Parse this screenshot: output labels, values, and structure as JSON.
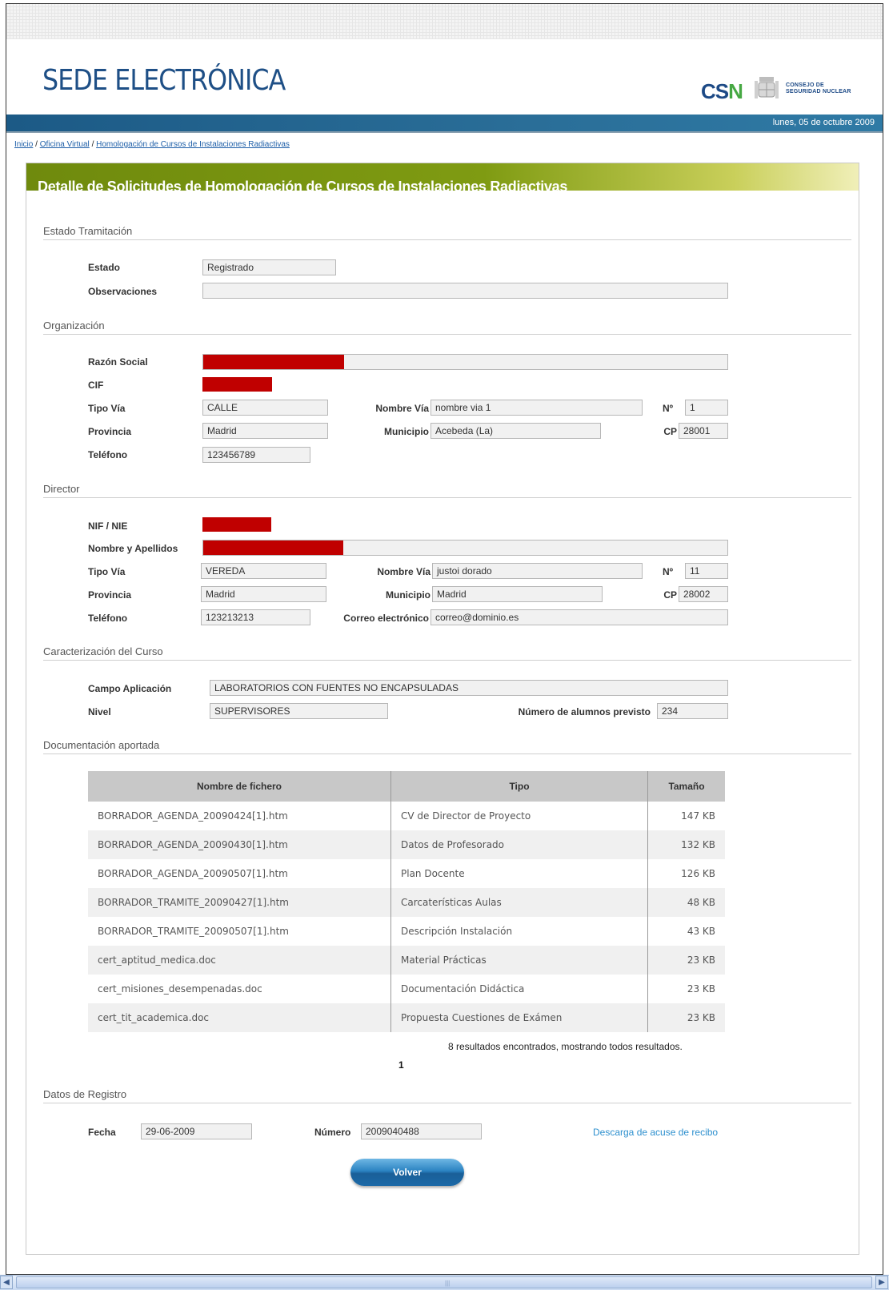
{
  "header": {
    "title": "SEDE ELECTRÓNICA",
    "logo": {
      "csn": "CSN",
      "line1": "CONSEJO DE",
      "line2": "SEGURIDAD NUCLEAR"
    },
    "date": "lunes, 05 de octubre 2009"
  },
  "breadcrumb": {
    "items": [
      "Inicio",
      "Oficina Virtual",
      "Homologación de Cursos de Instalaciones Radiactivas"
    ],
    "separator": "/"
  },
  "panel": {
    "title": "Detalle de Solicitudes de Homologación de Cursos de Instalaciones Radiactivas"
  },
  "estado_tramitacion": {
    "section": "Estado Tramitación",
    "estado_label": "Estado",
    "estado_value": "Registrado",
    "observaciones_label": "Observaciones",
    "observaciones_value": ""
  },
  "organizacion": {
    "section": "Organización",
    "razon_social_label": "Razón Social",
    "cif_label": "CIF",
    "tipo_via_label": "Tipo Vía",
    "tipo_via_value": "CALLE",
    "nombre_via_label": "Nombre Vía",
    "nombre_via_value": "nombre via 1",
    "numero_label": "Nº",
    "numero_value": "1",
    "provincia_label": "Provincia",
    "provincia_value": "Madrid",
    "municipio_label": "Municipio",
    "municipio_value": "Acebeda (La)",
    "cp_label": "CP",
    "cp_value": "28001",
    "telefono_label": "Teléfono",
    "telefono_value": "123456789"
  },
  "director": {
    "section": "Director",
    "nif_label": "NIF / NIE",
    "nombre_label": "Nombre y Apellidos",
    "tipo_via_label": "Tipo Vía",
    "tipo_via_value": "VEREDA",
    "nombre_via_label": "Nombre Vía",
    "nombre_via_value": "justoi dorado",
    "numero_label": "Nº",
    "numero_value": "11",
    "provincia_label": "Provincia",
    "provincia_value": "Madrid",
    "municipio_label": "Municipio",
    "municipio_value": "Madrid",
    "cp_label": "CP",
    "cp_value": "28002",
    "telefono_label": "Teléfono",
    "telefono_value": "123213213",
    "correo_label": "Correo electrónico",
    "correo_value": "correo@dominio.es"
  },
  "curso": {
    "section": "Caracterización del Curso",
    "campo_label": "Campo Aplicación",
    "campo_value": "LABORATORIOS CON FUENTES NO ENCAPSULADAS",
    "nivel_label": "Nivel",
    "nivel_value": "SUPERVISORES",
    "alumnos_label": "Número de alumnos previsto",
    "alumnos_value": "234"
  },
  "documentacion": {
    "section": "Documentación aportada",
    "headers": [
      "Nombre de fichero",
      "Tipo",
      "Tamaño"
    ],
    "rows": [
      [
        "BORRADOR_AGENDA_20090424[1].htm",
        "CV de Director de Proyecto",
        "147 KB"
      ],
      [
        "BORRADOR_AGENDA_20090430[1].htm",
        "Datos de Profesorado",
        "132 KB"
      ],
      [
        "BORRADOR_AGENDA_20090507[1].htm",
        "Plan Docente",
        "126 KB"
      ],
      [
        "BORRADOR_TRAMITE_20090427[1].htm",
        "Carcaterísticas Aulas",
        "48 KB"
      ],
      [
        "BORRADOR_TRAMITE_20090507[1].htm",
        "Descripción Instalación",
        "43 KB"
      ],
      [
        "cert_aptitud_medica.doc",
        "Material Prácticas",
        "23 KB"
      ],
      [
        "cert_misiones_desempenadas.doc",
        "Documentación Didáctica",
        "23 KB"
      ],
      [
        "cert_tit_academica.doc",
        "Propuesta Cuestiones de Exámen",
        "23 KB"
      ]
    ],
    "results_text": "8 resultados encontrados, mostrando todos resultados.",
    "page": "1"
  },
  "registro": {
    "section": "Datos de Registro",
    "fecha_label": "Fecha",
    "fecha_value": "29-06-2009",
    "numero_label": "Número",
    "numero_value": "2009040488",
    "acuse_link": "Descarga de acuse de recibo"
  },
  "actions": {
    "volver": "Volver"
  },
  "colors": {
    "brand_blue": "#1e4f86",
    "top_bar": "#1c5a86",
    "panel_header": "#7f9b12",
    "redaction": "#c00000",
    "link": "#2c8fce"
  }
}
